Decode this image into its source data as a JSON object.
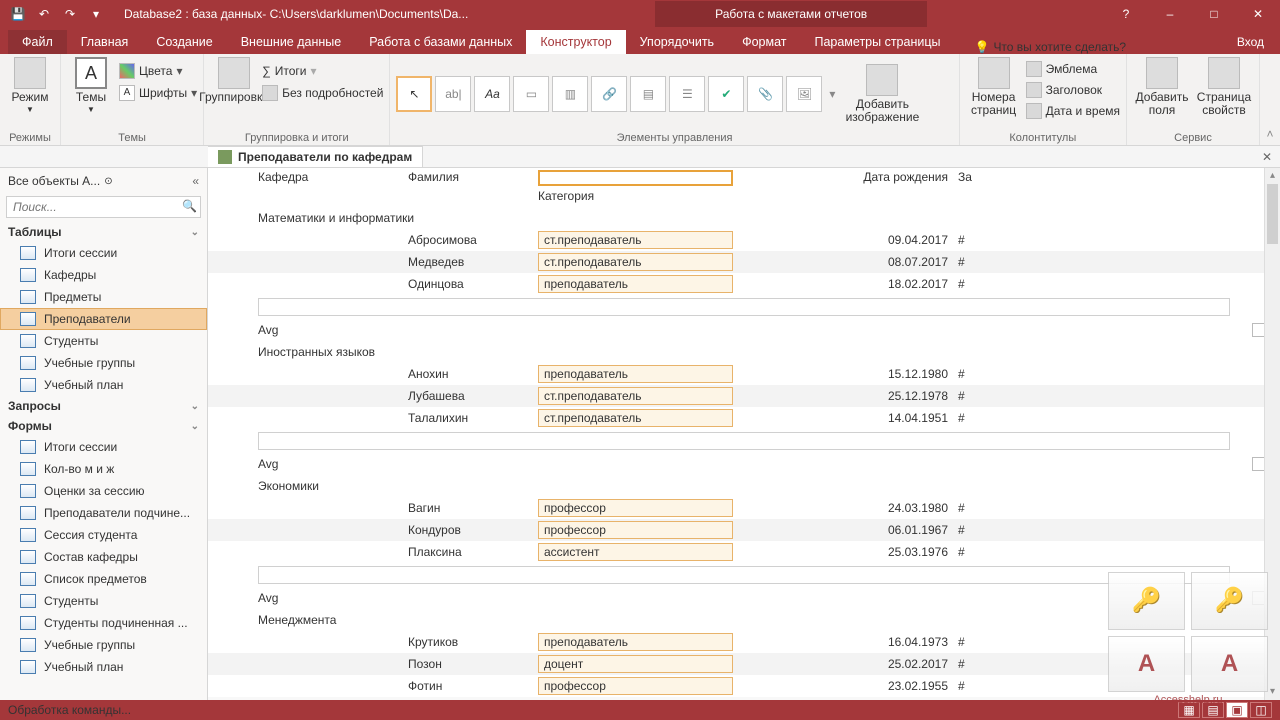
{
  "titlebar": {
    "title": "Database2 : база данных- C:\\Users\\darklumen\\Documents\\Da...",
    "context": "Работа с макетами отчетов"
  },
  "win": {
    "help": "?",
    "min": "–",
    "max": "□",
    "close": "✕"
  },
  "tabs": {
    "file": "Файл",
    "home": "Главная",
    "create": "Создание",
    "external": "Внешние данные",
    "dbtools": "Работа с базами данных",
    "design": "Конструктор",
    "arrange": "Упорядочить",
    "format": "Формат",
    "page": "Параметры страницы",
    "tell": "Что вы хотите сделать?",
    "login": "Вход"
  },
  "ribbon": {
    "views": {
      "label": "Режимы",
      "btn": "Режим"
    },
    "themes": {
      "label": "Темы",
      "btn": "Темы",
      "colors": "Цвета",
      "fonts": "Шрифты"
    },
    "grouping": {
      "label": "Группировка и итоги",
      "btn": "Группировка",
      "totals": "Итоги",
      "nodetails": "Без подробностей"
    },
    "controls": {
      "label": "Элементы управления",
      "insertimg": "Добавить\nизображение"
    },
    "headerfooter": {
      "label": "Колонтитулы",
      "pagenum": "Номера\nстраниц",
      "emblem": "Эмблема",
      "title": "Заголовок",
      "datetime": "Дата и время"
    },
    "tools": {
      "label": "Сервис",
      "addfields": "Добавить\nполя",
      "propsheet": "Страница\nсвойств"
    }
  },
  "doc": {
    "tab": "Преподаватели по кафедрам"
  },
  "nav": {
    "header": "Все объекты A...",
    "search": "Поиск...",
    "cat_tables": "Таблицы",
    "cat_queries": "Запросы",
    "cat_forms": "Формы",
    "tables": [
      "Итоги сессии",
      "Кафедры",
      "Предметы",
      "Преподаватели",
      "Студенты",
      "Учебные группы",
      "Учебный план"
    ],
    "tables_active": 3,
    "forms": [
      "Итоги сессии",
      "Кол-во м и ж",
      "Оценки за сессию",
      "Преподаватели подчине...",
      "Сессия студента",
      "Состав кафедры",
      "Список предметов",
      "Студенты",
      "Студенты подчиненная ...",
      "Учебные группы",
      "Учебный план"
    ]
  },
  "report": {
    "headers": {
      "dept": "Кафедра",
      "fam": "Фамилия",
      "cat": "Категория",
      "date": "Дата рождения",
      "extra": "За"
    },
    "avg": "Avg",
    "groups": [
      {
        "dept": "Математики и информатики",
        "rows": [
          {
            "fam": "Абросимова",
            "cat": "ст.преподаватель",
            "date": "09.04.2017",
            "z": false
          },
          {
            "fam": "Медведев",
            "cat": "ст.преподаватель",
            "date": "08.07.2017",
            "z": true
          },
          {
            "fam": "Одинцова",
            "cat": "преподаватель",
            "date": "18.02.2017",
            "z": false
          }
        ]
      },
      {
        "dept": "Иностранных языков",
        "rows": [
          {
            "fam": "Анохин",
            "cat": "преподаватель",
            "date": "15.12.1980",
            "z": false
          },
          {
            "fam": "Лубашева",
            "cat": "ст.преподаватель",
            "date": "25.12.1978",
            "z": true
          },
          {
            "fam": "Талалихин",
            "cat": "ст.преподаватель",
            "date": "14.04.1951",
            "z": false
          }
        ]
      },
      {
        "dept": "Экономики",
        "rows": [
          {
            "fam": "Вагин",
            "cat": "профессор",
            "date": "24.03.1980",
            "z": false
          },
          {
            "fam": "Кондуров",
            "cat": "профессор",
            "date": "06.01.1967",
            "z": true
          },
          {
            "fam": "Плаксина",
            "cat": "ассистент",
            "date": "25.03.1976",
            "z": false
          }
        ]
      },
      {
        "dept": "Менеджмента",
        "noavg": true,
        "rows": [
          {
            "fam": "Крутиков",
            "cat": "преподаватель",
            "date": "16.04.1973",
            "z": false
          },
          {
            "fam": "Позон",
            "cat": "доцент",
            "date": "25.02.2017",
            "z": true
          },
          {
            "fam": "Фотин",
            "cat": "профессор",
            "date": "23.02.1955",
            "z": false
          }
        ]
      }
    ]
  },
  "status": {
    "text": "Обработка команды..."
  },
  "watermark": {
    "url": "Accesshelp.ru"
  }
}
